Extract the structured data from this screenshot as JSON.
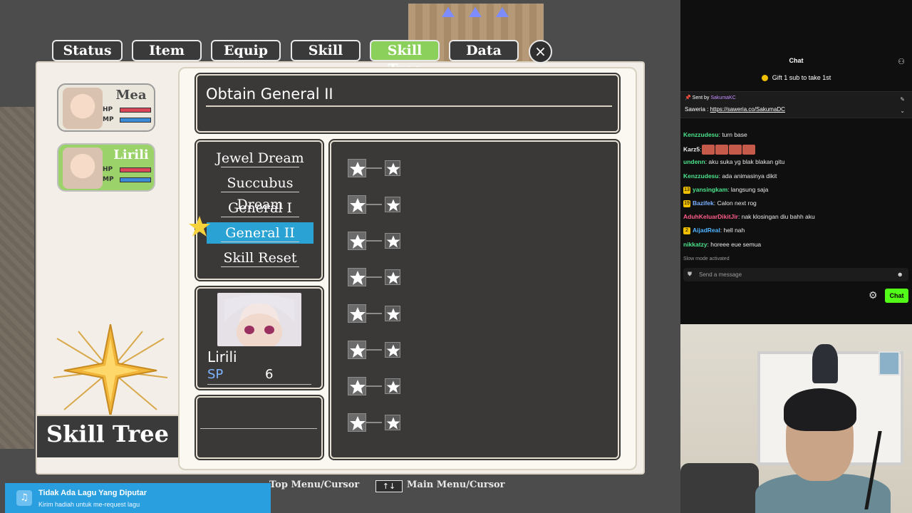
{
  "game": {
    "tabs": [
      {
        "label": "Status"
      },
      {
        "label": "Item"
      },
      {
        "label": "Equip"
      },
      {
        "label": "Skill"
      },
      {
        "label": "Skill Tree",
        "active": true
      },
      {
        "label": "Data"
      }
    ],
    "close_label": "×",
    "party": [
      {
        "name": "Mea",
        "hp_label": "HP",
        "mp_label": "MP",
        "active": false
      },
      {
        "name": "Lirili",
        "hp_label": "HP",
        "mp_label": "MP",
        "active": true
      }
    ],
    "screen_title": "Skill Tree",
    "obtain_title": "Obtain General II",
    "skill_menu": [
      {
        "label": "Jewel Dream"
      },
      {
        "label": "Succubus Dream"
      },
      {
        "label": "General I"
      },
      {
        "label": "General II",
        "selected": true
      },
      {
        "label": "Skill Reset"
      }
    ],
    "character": {
      "name": "Lirili",
      "sp_label": "SP",
      "sp_value": "6"
    },
    "star_rows": 8,
    "hints": [
      {
        "key": "",
        "text": "Top Menu/Cursor"
      },
      {
        "key": "↑↓",
        "text": "Main Menu/Cursor"
      }
    ],
    "colors": {
      "active_tab": "#8bd05a",
      "selected_menu": "#2aa3d4",
      "sp_label": "#7db4ff"
    }
  },
  "music": {
    "title": "Tidak Ada Lagu Yang Diputar",
    "subtitle": "Kirim hadiah untuk me-request lagu",
    "icon": "music-note-icon"
  },
  "chat": {
    "header": "Chat",
    "gift_text": "Gift 1 sub to take 1st",
    "pinned": {
      "sent_by_label": "Sent by",
      "sent_by_user": "SakumaKC",
      "message_prefix": "Saweria : ",
      "link": "https://saweria.co/SakumaDC"
    },
    "messages": [
      {
        "user": "Kenzzudesu",
        "text": ": turn base",
        "color": "#4be38b",
        "badge": ""
      },
      {
        "user": "Karz5",
        "text": ":",
        "color": "#f0f0f0",
        "badge": "",
        "emotes": 4
      },
      {
        "user": "undenn",
        "text": ": aku suka yg blak blakan gitu",
        "color": "#4be38b",
        "badge": ""
      },
      {
        "user": "Kenzzudesu",
        "text": ": ada animasinya dikit",
        "color": "#4be38b",
        "badge": ""
      },
      {
        "user": "yansingkam",
        "text": ": langsung saja",
        "color": "#4be38b",
        "badge": "13"
      },
      {
        "user": "Bazifek",
        "text": ": Calon next rog",
        "color": "#7ab0ff",
        "badge": "19"
      },
      {
        "user": "AduhKeluarDikitJir",
        "text": ": nak klosingan diu bahh aku",
        "color": "#ff5c8a",
        "badge": ""
      },
      {
        "user": "AijadReal",
        "text": ": hell nah",
        "color": "#4fb3ff",
        "badge": "2"
      },
      {
        "user": "nikkatzy",
        "text": ": horeee eue semua",
        "color": "#4be38b",
        "badge": ""
      }
    ],
    "slow_mode": "Slow mode activated",
    "input_placeholder": "Send a message",
    "send_button": "Chat"
  }
}
